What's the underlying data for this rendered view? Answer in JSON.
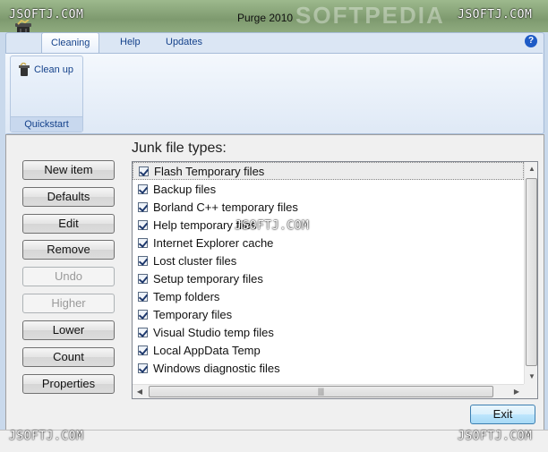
{
  "window": {
    "title": "Purge 2010",
    "bg_ghost": "SOFTPEDIA"
  },
  "watermark": "JSOFTJ.COM",
  "ribbon": {
    "tabs": [
      {
        "label": "Cleaning",
        "active": true
      },
      {
        "label": "Help",
        "active": false
      },
      {
        "label": "Updates",
        "active": false
      }
    ],
    "group": {
      "button_label": "Clean up",
      "group_label": "Quickstart"
    }
  },
  "main": {
    "list_title": "Junk file types:",
    "buttons": [
      {
        "label": "New item",
        "enabled": true
      },
      {
        "label": "Defaults",
        "enabled": true
      },
      {
        "label": "Edit",
        "enabled": true
      },
      {
        "label": "Remove",
        "enabled": true
      },
      {
        "label": "Undo",
        "enabled": false
      },
      {
        "label": "Higher",
        "enabled": false
      },
      {
        "label": "Lower",
        "enabled": true
      },
      {
        "label": "Count",
        "enabled": true
      },
      {
        "label": "Properties",
        "enabled": true
      }
    ],
    "items": [
      "Flash Temporary files",
      "Backup files",
      "Borland C++ temporary files",
      "Help temporary files",
      "Internet Explorer cache",
      "Lost cluster files",
      "Setup temporary files",
      "Temp folders",
      "Temporary files",
      "Visual Studio temp files",
      "Local AppData Temp",
      "Windows diagnostic files"
    ],
    "exit_label": "Exit"
  }
}
